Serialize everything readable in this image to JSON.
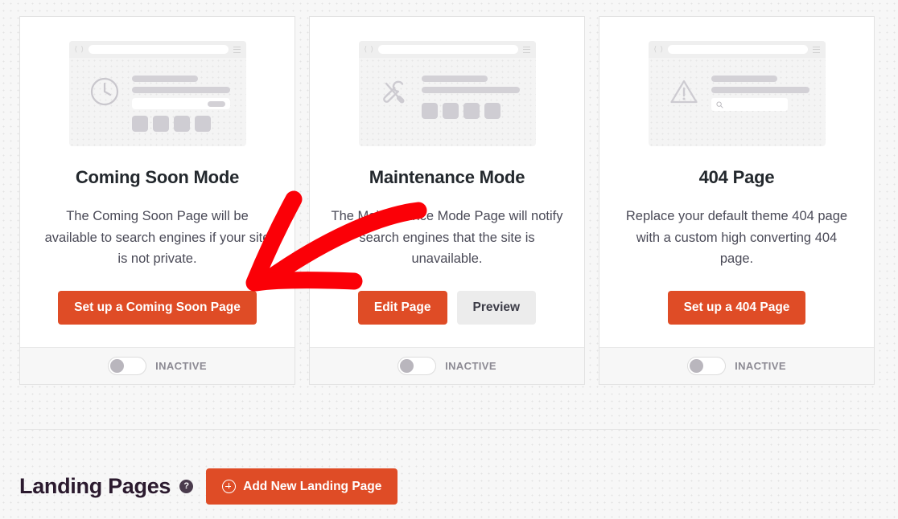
{
  "page": {
    "background_color": "#f7f7f7",
    "accent_color": "#df4c26"
  },
  "cards": [
    {
      "id": "coming-soon",
      "title": "Coming Soon Mode",
      "description": "The Coming Soon Page will be available to search engines if your site is not private.",
      "illustration_icon": "clock-icon",
      "buttons": [
        {
          "label": "Set up a Coming Soon Page",
          "style": "primary"
        }
      ],
      "toggle_state": "INACTIVE"
    },
    {
      "id": "maintenance-mode",
      "title": "Maintenance Mode",
      "description": "The Maintenance Mode Page will notify search engines that the site is unavailable.",
      "illustration_icon": "tools-icon",
      "buttons": [
        {
          "label": "Edit Page",
          "style": "primary"
        },
        {
          "label": "Preview",
          "style": "secondary"
        }
      ],
      "toggle_state": "INACTIVE"
    },
    {
      "id": "404-page",
      "title": "404 Page",
      "description": "Replace your default theme 404 page with a custom high converting 404 page.",
      "illustration_icon": "warning-triangle-icon",
      "buttons": [
        {
          "label": "Set up a 404 Page",
          "style": "primary"
        }
      ],
      "toggle_state": "INACTIVE"
    }
  ],
  "landing_section": {
    "title": "Landing Pages",
    "help_icon_glyph": "?",
    "add_button_label": "Add New Landing Page",
    "add_button_icon": "plus-circle-icon"
  },
  "annotation": {
    "type": "red-arrow",
    "color": "#fb0007",
    "points_to": "Set up a Coming Soon Page"
  }
}
